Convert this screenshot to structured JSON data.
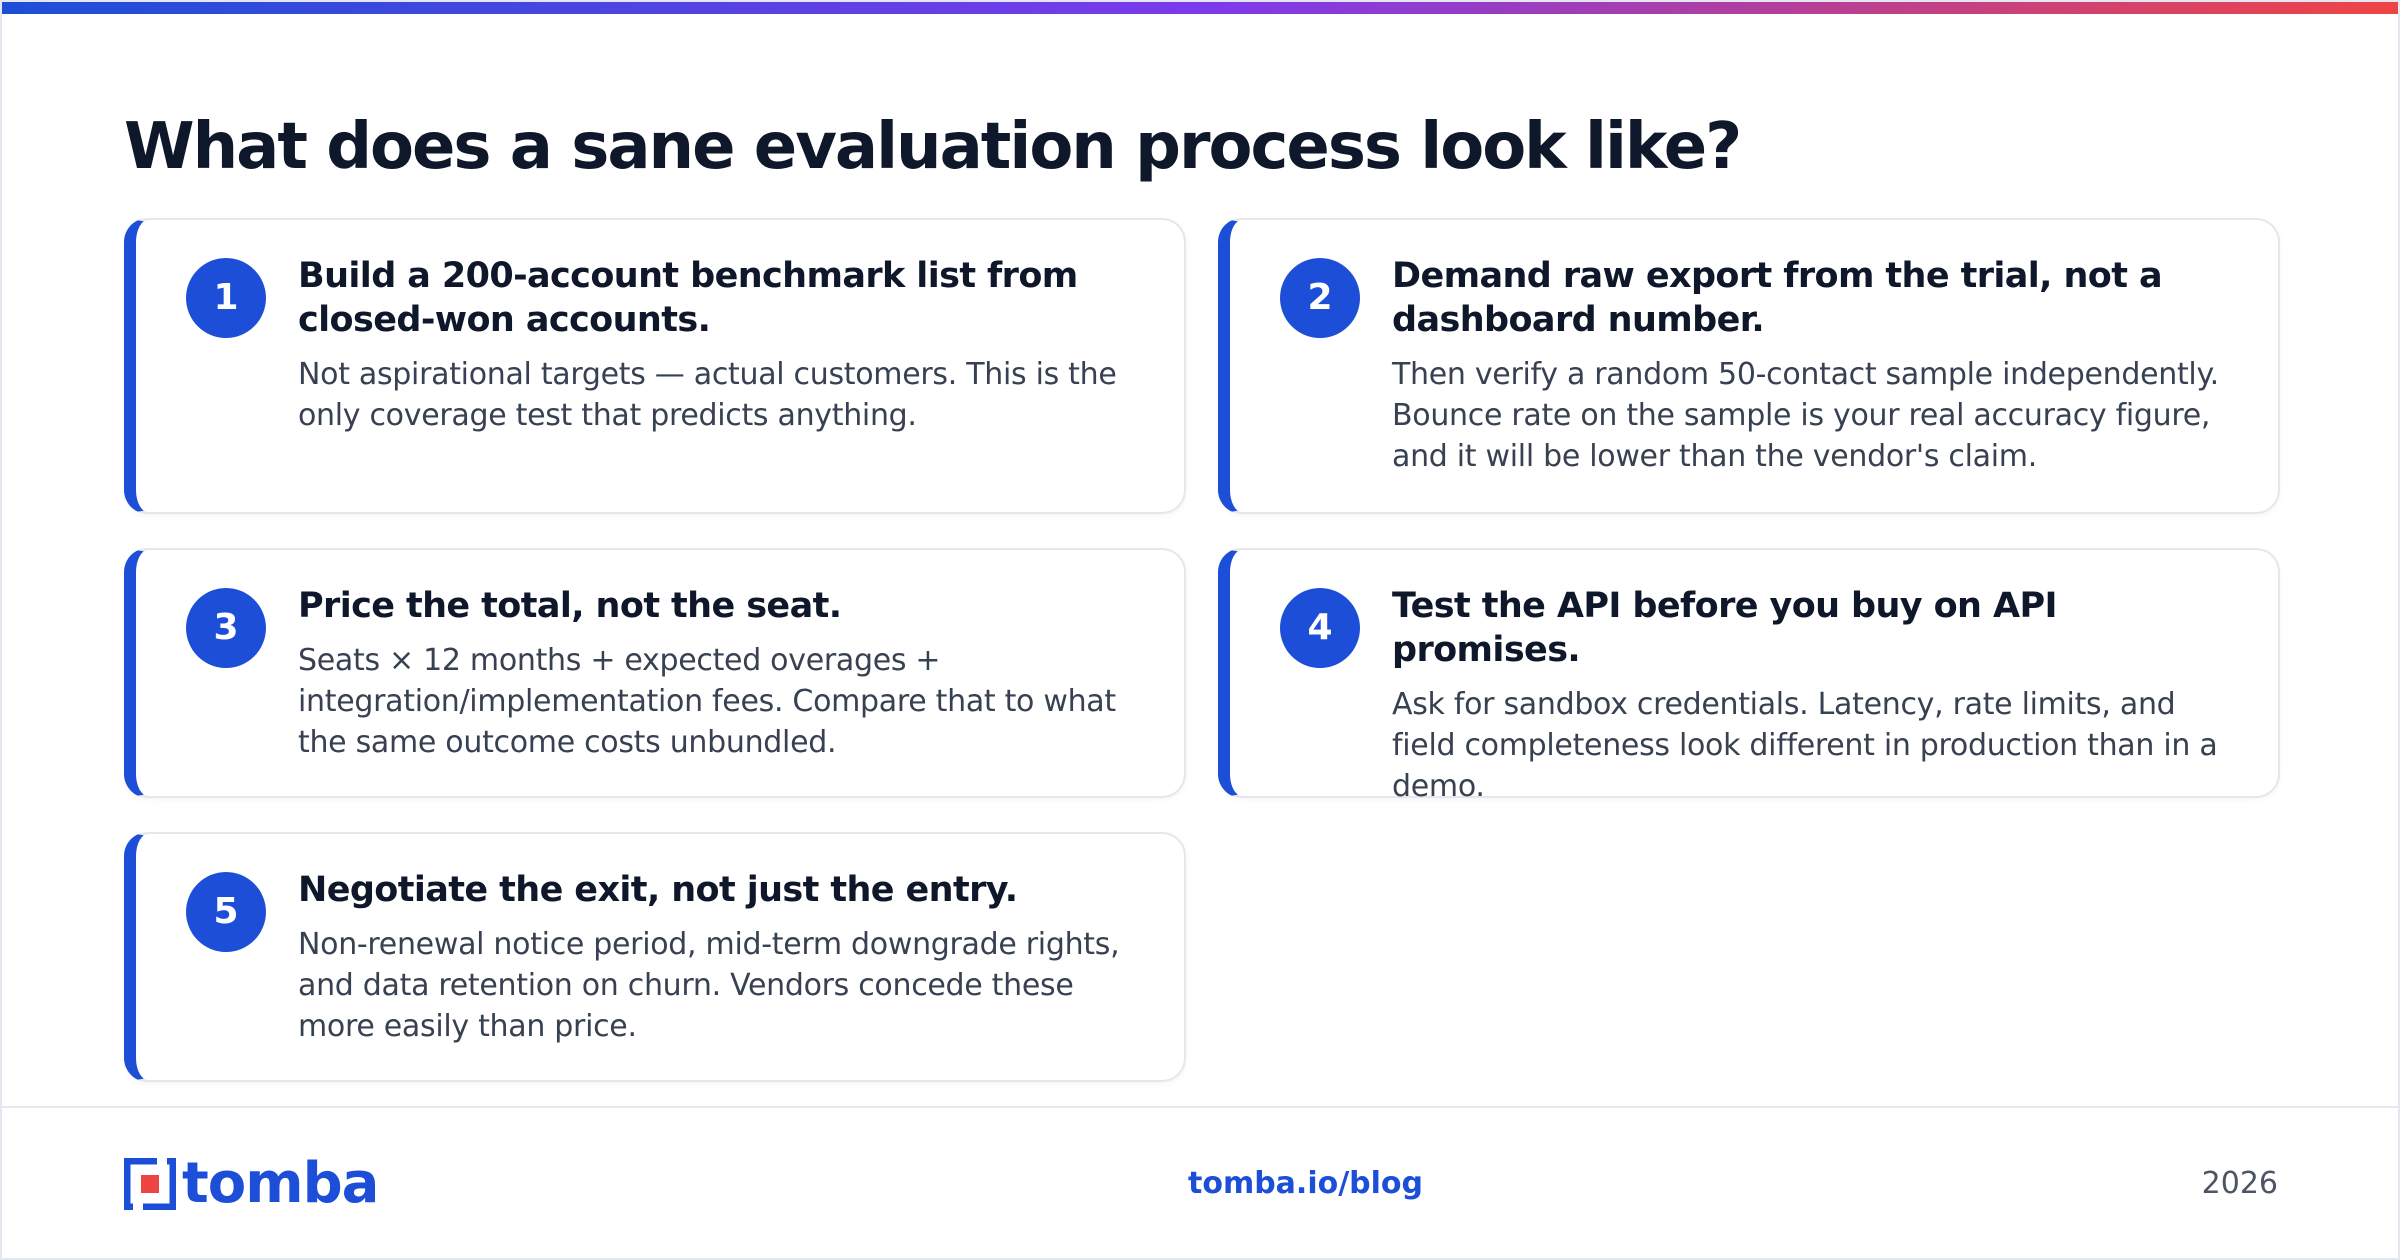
{
  "header": {
    "title": "What does a sane evaluation process look like?",
    "accent_colors": [
      "#1d4ed8",
      "#7c3aed",
      "#ef4444"
    ]
  },
  "steps": [
    {
      "number": "1",
      "title": "Build a 200-account benchmark list from closed-won accounts.",
      "body": "Not aspirational targets — actual customers. This is the only coverage test that predicts anything."
    },
    {
      "number": "2",
      "title": "Demand raw export from the trial, not a dashboard number.",
      "body": "Then verify a random 50-contact sample independently. Bounce rate on the sample is your real accuracy figure, and it will be lower than the vendor's claim."
    },
    {
      "number": "3",
      "title": "Price the total, not the seat.",
      "body": "Seats × 12 months + expected overages + integration/implementation fees. Compare that to what the same outcome costs unbundled."
    },
    {
      "number": "4",
      "title": "Test the API before you buy on API promises.",
      "body": "Ask for sandbox credentials. Latency, rate limits, and field completeness look different in production than in a demo."
    },
    {
      "number": "5",
      "title": "Negotiate the exit, not just the entry.",
      "body": "Non-renewal notice period, mid-term downgrade rights, and data retention on churn. Vendors concede these more easily than price."
    }
  ],
  "footer": {
    "logo_text": "tomba",
    "link": "tomba.io/blog",
    "year": "2026",
    "brand_color": "#1d4ed8",
    "logo_accent_color": "#ef4444"
  }
}
